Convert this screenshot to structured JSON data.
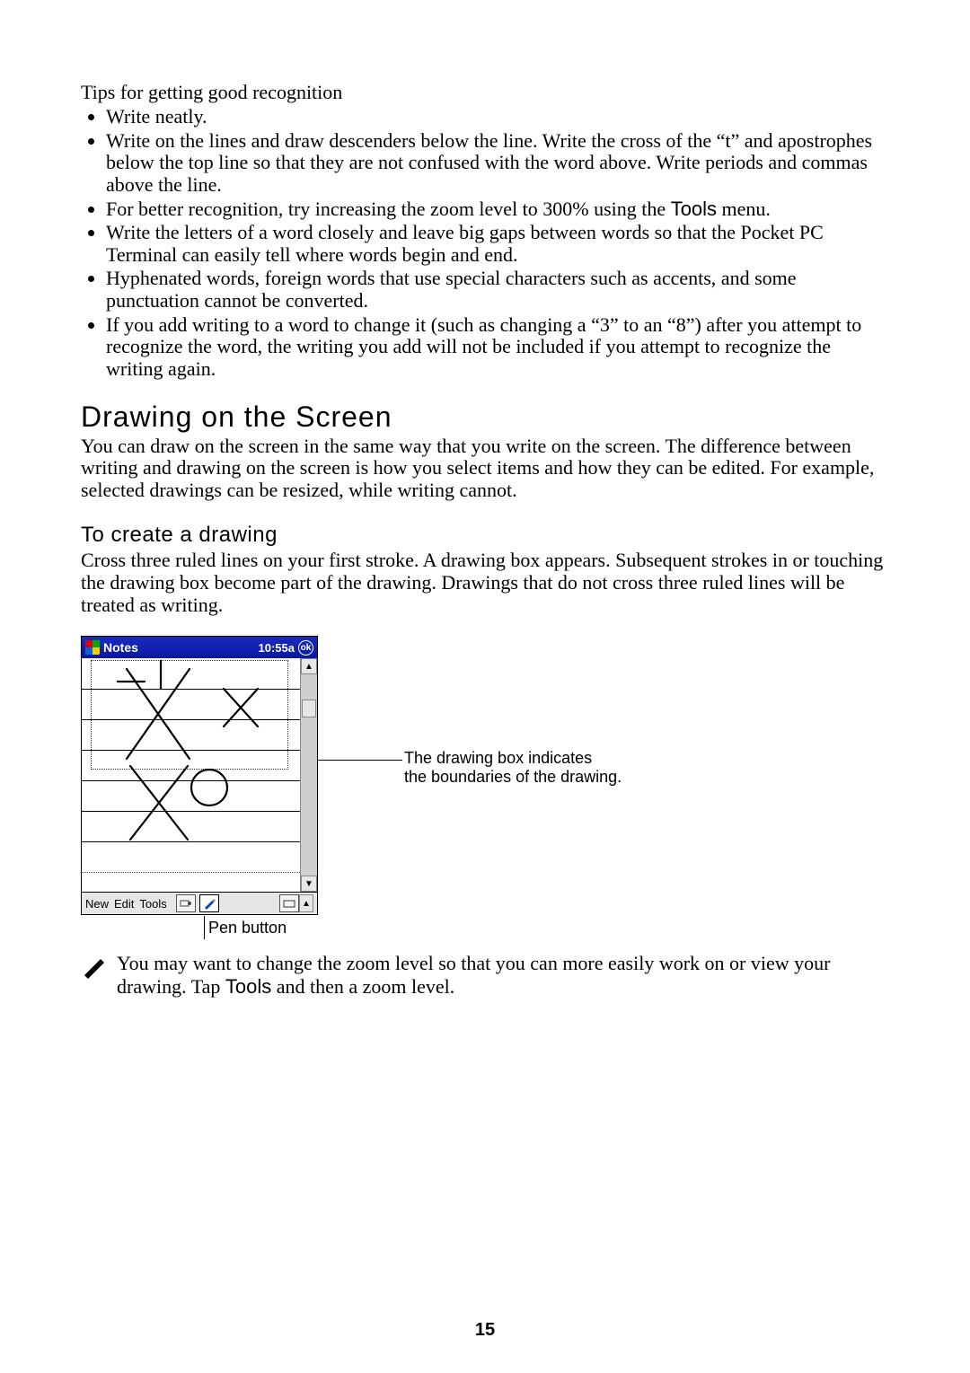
{
  "tips_intro": "Tips for getting good recognition",
  "tips": [
    "Write neatly.",
    "Write on the lines and draw descenders below the line. Write the cross of the “t” and apostrophes below the top line so that they are not confused with the word above. Write periods and commas above the line.",
    "For better recognition, try increasing the zoom level to 300% using the Tools menu.",
    "Write the letters of a word closely and leave big gaps between words so that the Pocket PC Terminal can easily tell where words begin and end.",
    "Hyphenated words, foreign words that use special characters such as accents, and some punctuation cannot be converted.",
    "If you add writing to a word to change it (such as changing a “3” to an “8”) after you attempt to recognize the word, the writing you add will not be included if you attempt to recognize the writing again."
  ],
  "section_heading": "Drawing on the Screen",
  "section_body": "You can draw on the screen in the same way that you write on the screen. The difference between writing and drawing on the screen is how you select items and how they can be edited. For example, selected drawings can be resized, while writing cannot.",
  "subsection_heading": "To create a drawing",
  "subsection_body": "Cross three ruled lines on your first stroke. A drawing box appears. Subsequent strokes in or touching the drawing box become part of the drawing. Drawings that do not cross three ruled lines will be treated as writing.",
  "screenshot": {
    "app_title": "Notes",
    "time": "10:55a",
    "ok_label": "ok",
    "menu": {
      "new": "New",
      "edit": "Edit",
      "tools": "Tools"
    }
  },
  "callout_right_line1": "The drawing box indicates",
  "callout_right_line2": "the boundaries of the drawing.",
  "callout_pen": "Pen button",
  "note_text_part1": "You may want to change the zoom level so that you can more easily work on or view your drawing. Tap ",
  "note_text_tools": "Tools",
  "note_text_part2": " and then a zoom level.",
  "page_number": "15"
}
